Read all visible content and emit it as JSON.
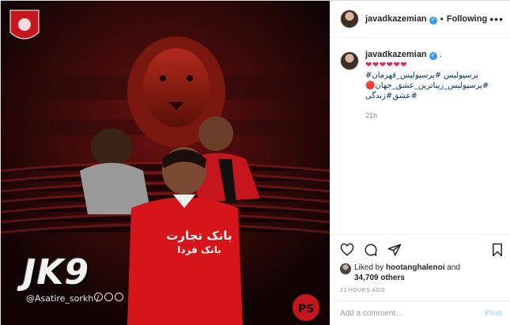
{
  "post": {
    "author": "javadkazemian",
    "follow_status": "Following",
    "more_glyph": "•••",
    "caption": {
      "hearts": "❤❤❤❤❤❤",
      "dot": ".",
      "lines": [
        "پرسپولیس #پرسپولیس_قهرمان#",
        "#پرسپولیس_زیباترین_عشق_جهان🔴",
        "#عشق#زندگی"
      ],
      "age": "21h"
    },
    "likes": {
      "prefix": "Liked by",
      "user": "hootanghalenoi",
      "conjunction": "and",
      "count": "34,709 others"
    },
    "posted_ago": "21 HOURS AGO",
    "add_comment": {
      "placeholder": "Add a comment…",
      "post_label": "Post"
    }
  },
  "media": {
    "big_label": "JK9",
    "credit": "@Asatire_sorkh /",
    "jersey_line1": "بانک تجارت",
    "jersey_line2": "بانک فردا",
    "accent": "#d6151b",
    "background": "#140505"
  },
  "icons": [
    "verified-badge",
    "heart-icon",
    "comment-icon",
    "share-icon",
    "save-icon",
    "more-icon"
  ]
}
